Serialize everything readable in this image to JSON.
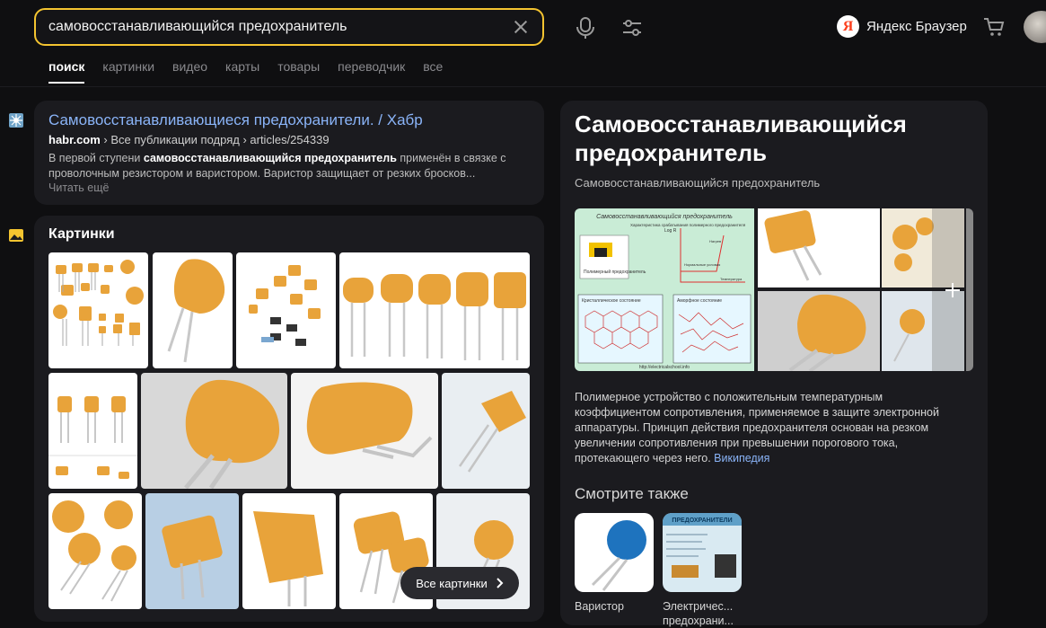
{
  "search": {
    "query": "самовосстанавливающийся предохранитель"
  },
  "header": {
    "browser_label": "Яндекс Браузер",
    "logo_letter": "Я"
  },
  "tabs": [
    {
      "label": "поиск",
      "active": true
    },
    {
      "label": "картинки"
    },
    {
      "label": "видео"
    },
    {
      "label": "карты"
    },
    {
      "label": "товары"
    },
    {
      "label": "переводчик"
    },
    {
      "label": "все"
    }
  ],
  "result": {
    "title": "Самовосстанавливающиеся предохранители.",
    "source": "/ Хабр",
    "domain": "habr.com",
    "path": "› Все публикации подряд › articles/254339",
    "snippet_prefix": "В первой ступени ",
    "snippet_bold": "самовосстанавливающийся предохранитель",
    "snippet_rest": " применён в связке с проволочным резистором и варистором. Варистор защищает от резких бросков...",
    "more": "Читать ещё"
  },
  "images": {
    "heading": "Картинки",
    "all_button": "Все картинки"
  },
  "wiki": {
    "title": "Самовосстанавливающийся предохранитель",
    "subtitle": "Самовосстанавливающийся предохранитель",
    "description": "Полимерное устройство с положительным температурным коэффициентом сопротивления, применяемое в защите электронной аппаратуры. Принцип действия предохранителя основан на резком увеличении сопротивления при превышении порогового тока, протекающего через него.",
    "source_link": "Википедия",
    "diagram": {
      "title": "Самовосстанавливающийся предохранитель",
      "lbl_graph": "Характеристика срабатывания полимерного предохранителя",
      "lbl_polymer": "Полимерный предохранитель",
      "lbl_crystal": "Кристаллическое состояние",
      "lbl_amorph": "Аморфное состояние",
      "lbl_url": "http://electricalschool.info",
      "lbl_log": "Log R",
      "lbl_norm": "Нормальные условия",
      "lbl_temp": "Температура",
      "lbl_load": "Нагрев"
    },
    "see_also_heading": "Смотрите также",
    "see_also": [
      {
        "label": "Варистор"
      },
      {
        "label": "Электричес... предохрани..."
      }
    ],
    "see_also_thumb_text": "ПРЕДОХРАНИТЕЛИ"
  },
  "colors": {
    "accent": "#f4c430",
    "link": "#8ab4f8",
    "fuse": "#e8a33a",
    "bg": "#0f0f11",
    "card": "#1b1b1f"
  }
}
